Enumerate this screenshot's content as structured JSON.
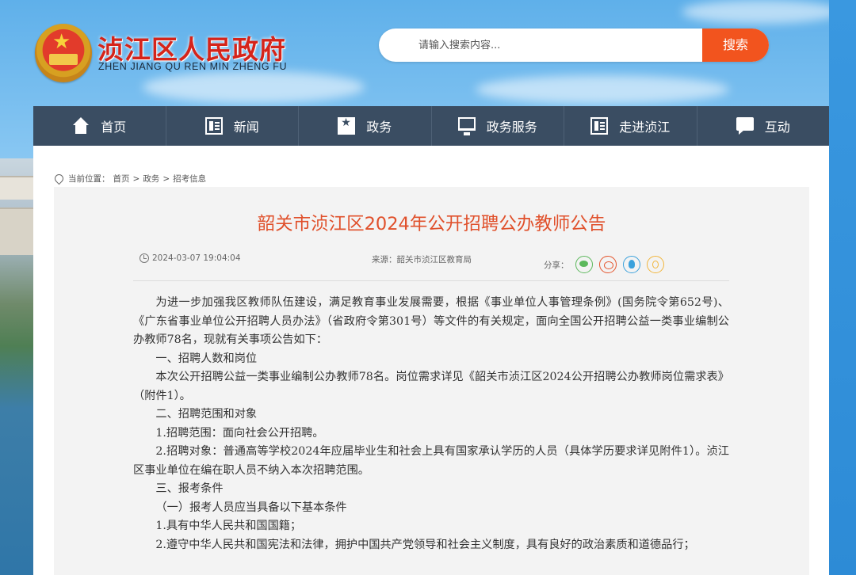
{
  "header": {
    "title": "浈江区人民政府",
    "subtitle": "ZHEN JIANG QU REN MIN ZHENG FU",
    "search_placeholder": "请输入搜索内容...",
    "search_button": "搜索"
  },
  "nav": {
    "items": [
      {
        "label": "首页",
        "icon": "home-icon"
      },
      {
        "label": "新闻",
        "icon": "news-icon"
      },
      {
        "label": "政务",
        "icon": "gov-affairs-icon"
      },
      {
        "label": "政务服务",
        "icon": "monitor-icon"
      },
      {
        "label": "走进浈江",
        "icon": "book-icon"
      },
      {
        "label": "互动",
        "icon": "chat-icon"
      }
    ]
  },
  "breadcrumb": {
    "label": "当前位置：",
    "items": [
      "首页",
      "政务",
      "招考信息"
    ],
    "separator": ">"
  },
  "article": {
    "title": "韶关市浈江区2024年公开招聘公办教师公告",
    "date": "2024-03-07 19:04:04",
    "source": "来源：韶关市浈江区教育局",
    "share_label": "分享：",
    "share_icons": [
      "wechat-icon",
      "weibo-icon",
      "qq-icon",
      "qzone-icon"
    ],
    "paragraphs": [
      "为进一步加强我区教师队伍建设，满足教育事业发展需要，根据《事业单位人事管理条例》(国务院令第652号)、《广东省事业单位公开招聘人员办法》（省政府令第301号）等文件的有关规定，面向全国公开招聘公益一类事业编制公办教师78名，现就有关事项公告如下：",
      "一、招聘人数和岗位",
      "本次公开招聘公益一类事业编制公办教师78名。岗位需求详见《韶关市浈江区2024公开招聘公办教师岗位需求表》（附件1）。",
      "二、招聘范围和对象",
      "1.招聘范围：面向社会公开招聘。",
      "2.招聘对象：普通高等学校2024年应届毕业生和社会上具有国家承认学历的人员（具体学历要求详见附件1）。浈江区事业单位在编在职人员不纳入本次招聘范围。",
      "三、报考条件",
      "（一）报考人员应当具备以下基本条件",
      "1.具有中华人民共和国国籍；",
      "2.遵守中华人民共和国宪法和法律，拥护中国共产党领导和社会主义制度，具有良好的政治素质和道德品行；"
    ]
  },
  "colors": {
    "title_red": "#d5241a",
    "nav_bg": "#3a4d62",
    "search_orange": "#f2541e",
    "article_title": "#e0502b"
  }
}
